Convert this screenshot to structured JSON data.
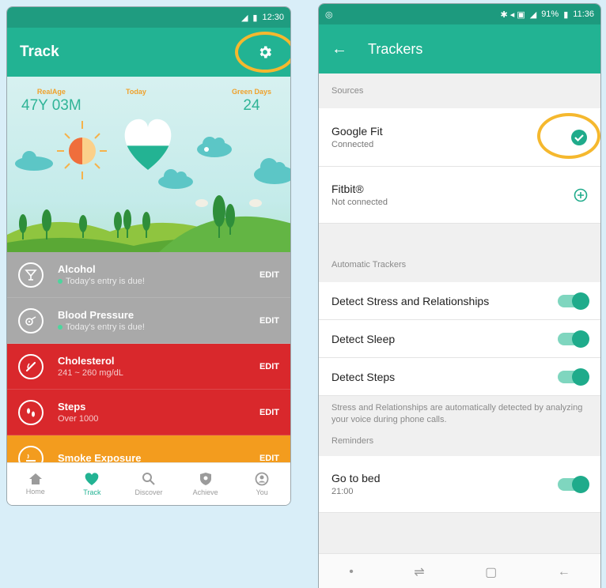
{
  "left": {
    "status": {
      "time": "12:30"
    },
    "appbar": {
      "title": "Track"
    },
    "stats": {
      "realage_label": "RealAge",
      "realage_value": "47Y 03M",
      "today_label": "Today",
      "green_label": "Green Days",
      "green_value": "24"
    },
    "today_heart_fill": 0.45,
    "rows": [
      {
        "name": "Alcohol",
        "sub": "Today's entry is due!",
        "edit": "EDIT",
        "icon": "cocktail-icon"
      },
      {
        "name": "Blood Pressure",
        "sub": "Today's entry is due!",
        "edit": "EDIT",
        "icon": "blood-pressure-icon"
      },
      {
        "name": "Cholesterol",
        "sub": "241 ~ 260 mg/dL",
        "edit": "EDIT",
        "icon": "cholesterol-icon"
      },
      {
        "name": "Steps",
        "sub": "Over 1000",
        "edit": "EDIT",
        "icon": "footsteps-icon"
      },
      {
        "name": "Smoke Exposure",
        "sub": "",
        "edit": "EDIT",
        "icon": "smoke-icon"
      }
    ],
    "nav": [
      {
        "label": "Home",
        "icon": "home-icon"
      },
      {
        "label": "Track",
        "icon": "heart-icon"
      },
      {
        "label": "Discover",
        "icon": "search-icon"
      },
      {
        "label": "Achieve",
        "icon": "shield-icon"
      },
      {
        "label": "You",
        "icon": "person-icon"
      }
    ],
    "colors": {
      "teal": "#22b393",
      "gray_row": "#a9a9a9",
      "red_row": "#d9282c",
      "orange_row": "#f39c1e",
      "highlight": "#f5b82e"
    }
  },
  "right": {
    "status": {
      "battery": "91%",
      "time": "11:36"
    },
    "appbar": {
      "title": "Trackers"
    },
    "sources_header": "Sources",
    "sources": [
      {
        "name": "Google Fit",
        "sub": "Connected",
        "state": "connected"
      },
      {
        "name": "Fitbit®",
        "sub": "Not connected",
        "state": "add"
      }
    ],
    "auto_header": "Automatic Trackers",
    "auto": [
      {
        "name": "Detect Stress and Relationships",
        "on": true
      },
      {
        "name": "Detect Sleep",
        "on": true
      },
      {
        "name": "Detect Steps",
        "on": true
      }
    ],
    "auto_note": "Stress and Relationships are automatically detected by analyzing your voice during phone calls.",
    "reminders_header": "Reminders",
    "reminders": [
      {
        "name": "Go to bed",
        "sub": "21:00",
        "on": true
      }
    ]
  }
}
